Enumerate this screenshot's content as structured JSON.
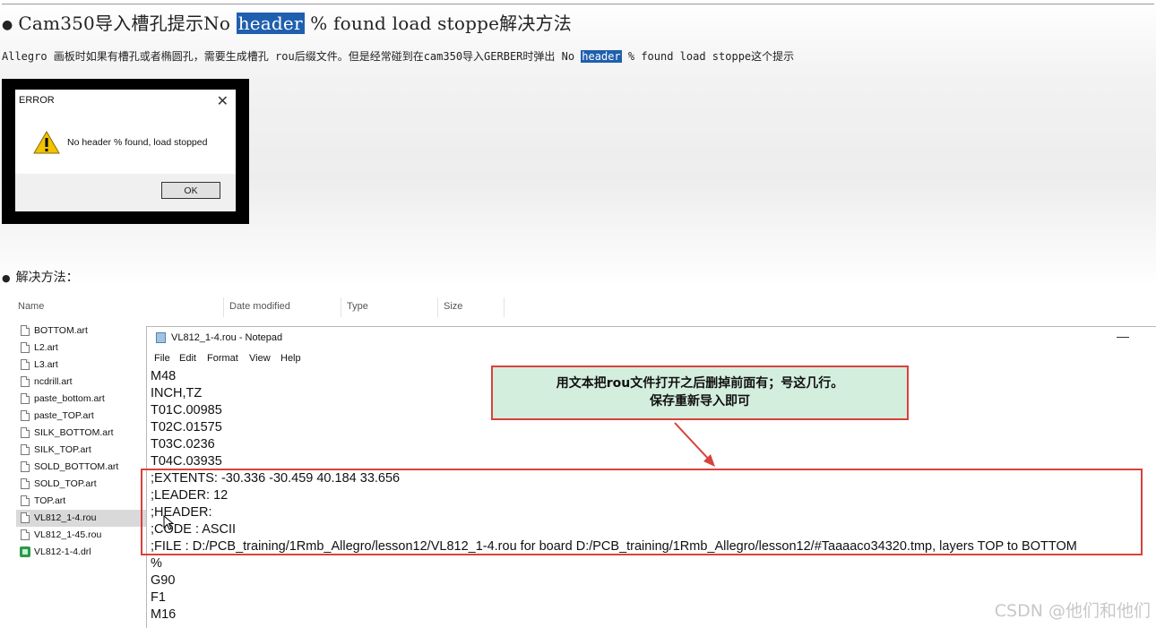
{
  "article": {
    "title_prefix": "Cam350导入槽孔提示No ",
    "title_highlight": "header",
    "title_suffix": " % found load stoppe解决方法",
    "desc_prefix": "Allegro 画板时如果有槽孔或者椭圆孔，需要生成槽孔 rou后缀文件。但是经常碰到在cam350导入GERBER时弹出 No ",
    "desc_highlight": "header",
    "desc_suffix": " % found load stoppe这个提示",
    "section_label": "解决方法："
  },
  "error_dialog": {
    "title": "ERROR",
    "message": "No header % found, load stopped",
    "ok_label": "OK"
  },
  "explorer": {
    "columns": [
      "Name",
      "Date modified",
      "Type",
      "Size"
    ],
    "files": [
      {
        "name": "BOTTOM.art",
        "icon": "file-icon"
      },
      {
        "name": "L2.art",
        "icon": "file-icon"
      },
      {
        "name": "L3.art",
        "icon": "file-icon"
      },
      {
        "name": "ncdrill.art",
        "icon": "file-icon"
      },
      {
        "name": "paste_bottom.art",
        "icon": "file-icon"
      },
      {
        "name": "paste_TOP.art",
        "icon": "file-icon"
      },
      {
        "name": "SILK_BOTTOM.art",
        "icon": "file-icon"
      },
      {
        "name": "SILK_TOP.art",
        "icon": "file-icon"
      },
      {
        "name": "SOLD_BOTTOM.art",
        "icon": "file-icon"
      },
      {
        "name": "SOLD_TOP.art",
        "icon": "file-icon"
      },
      {
        "name": "TOP.art",
        "icon": "file-icon"
      },
      {
        "name": "VL812_1-4.rou",
        "icon": "file-icon"
      },
      {
        "name": "VL812_1-45.rou",
        "icon": "file-icon"
      },
      {
        "name": "VL812-1-4.drl",
        "icon": "drill-file-icon"
      }
    ]
  },
  "notepad": {
    "title": "VL812_1-4.rou - Notepad",
    "menu": [
      "File",
      "Edit",
      "Format",
      "View",
      "Help"
    ],
    "lines": [
      "M48",
      "INCH,TZ",
      "T01C.00985",
      "T02C.01575",
      "T03C.0236",
      "T04C.03935",
      ";EXTENTS: -30.336 -30.459 40.184  33.656",
      ";LEADER: 12",
      ";HEADER:",
      ";CODE  : ASCII",
      ";FILE  : D:/PCB_training/1Rmb_Allegro/lesson12/VL812_1-4.rou for board D:/PCB_training/1Rmb_Allegro/lesson12/#Taaaaco34320.tmp, layers TOP to BOTTOM",
      "%",
      "G90",
      "F1",
      "M16"
    ]
  },
  "callout": {
    "line1": "用文本把rou文件打开之后删掉前面有；号这几行。",
    "line2": "保存重新导入即可"
  },
  "watermark": "CSDN @他们和他们",
  "colors": {
    "highlight": "#1f5fae",
    "annotation_red": "#d9413c",
    "callout_bg": "#d4eede"
  }
}
